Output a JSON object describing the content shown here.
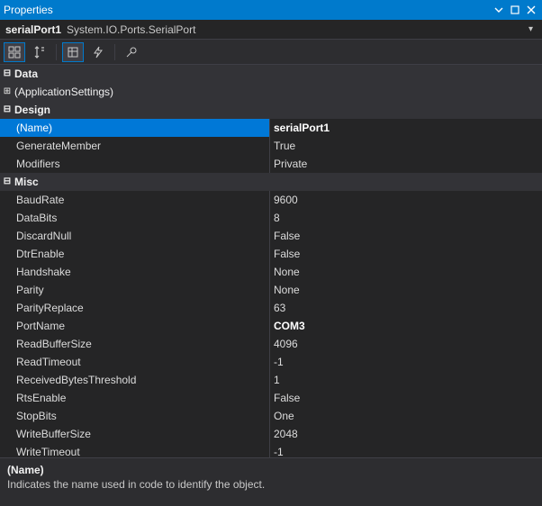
{
  "window": {
    "title": "Properties"
  },
  "object": {
    "name": "serialPort1",
    "type": "System.IO.Ports.SerialPort"
  },
  "categories": [
    {
      "label": "Data",
      "expanded": true,
      "items": []
    },
    {
      "label": "(ApplicationSettings)",
      "expanded": false,
      "items": [],
      "is_item_style": true
    },
    {
      "label": "Design",
      "expanded": true,
      "items": [
        {
          "name": "(Name)",
          "value": "serialPort1",
          "selected": true,
          "bold": true
        },
        {
          "name": "GenerateMember",
          "value": "True"
        },
        {
          "name": "Modifiers",
          "value": "Private"
        }
      ]
    },
    {
      "label": "Misc",
      "expanded": true,
      "items": [
        {
          "name": "BaudRate",
          "value": "9600"
        },
        {
          "name": "DataBits",
          "value": "8"
        },
        {
          "name": "DiscardNull",
          "value": "False"
        },
        {
          "name": "DtrEnable",
          "value": "False"
        },
        {
          "name": "Handshake",
          "value": "None"
        },
        {
          "name": "Parity",
          "value": "None"
        },
        {
          "name": "ParityReplace",
          "value": "63"
        },
        {
          "name": "PortName",
          "value": "COM3",
          "bold": true
        },
        {
          "name": "ReadBufferSize",
          "value": "4096"
        },
        {
          "name": "ReadTimeout",
          "value": "-1"
        },
        {
          "name": "ReceivedBytesThreshold",
          "value": "1"
        },
        {
          "name": "RtsEnable",
          "value": "False"
        },
        {
          "name": "StopBits",
          "value": "One"
        },
        {
          "name": "WriteBufferSize",
          "value": "2048"
        },
        {
          "name": "WriteTimeout",
          "value": "-1"
        }
      ]
    }
  ],
  "description": {
    "name": "(Name)",
    "text": "Indicates the name used in code to identify the object."
  }
}
